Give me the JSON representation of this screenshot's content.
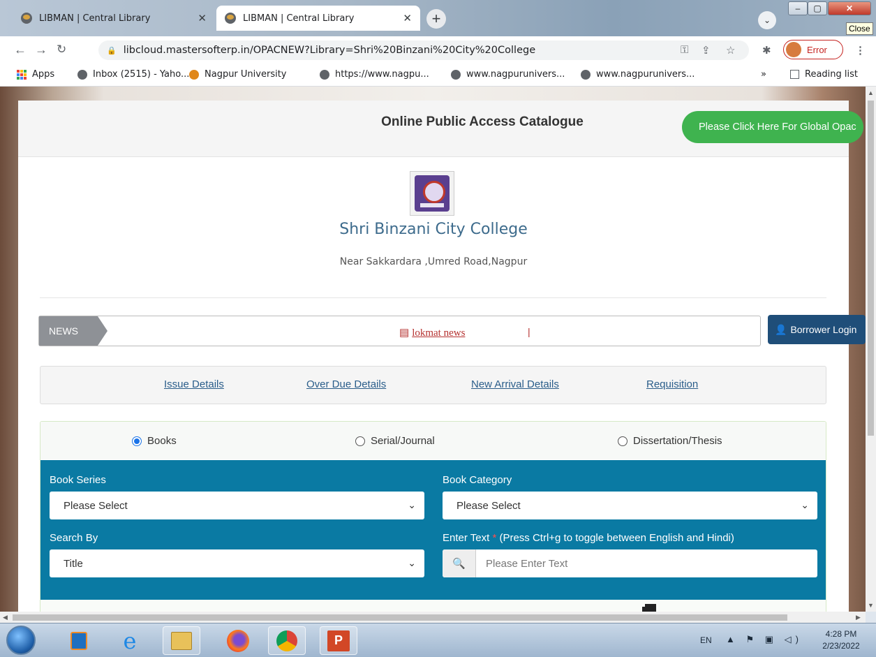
{
  "browser": {
    "tabs": [
      {
        "label": "LIBMAN | Central Library",
        "active": false
      },
      {
        "label": "LIBMAN | Central Library",
        "active": true
      }
    ],
    "close_tooltip": "Close",
    "url": "libcloud.mastersofterp.in/OPACNEW?Library=Shri%20Binzani%20City%20College",
    "profile_status": "Error",
    "bookmarks": [
      "Apps",
      "Inbox (2515) - Yaho...",
      "Nagpur University",
      "https://www.nagpu...",
      "www.nagpurunivers...",
      "www.nagpurunivers..."
    ],
    "bookmarks_overflow": "»",
    "reading_list": "Reading list"
  },
  "page": {
    "header_title": "Online Public Access Catalogue",
    "global_opac_button": "Please Click Here For Global Opac",
    "college_name": "Shri Binzani City College",
    "college_address": "Near Sakkardara ,Umred Road,Nagpur",
    "news": {
      "label": "NEWS",
      "item": "lokmat news",
      "separator": "|"
    },
    "borrower_login": "Borrower Login",
    "links": [
      "Issue Details",
      "Over Due Details",
      "New Arrival Details",
      "Requisition"
    ],
    "material_types": [
      {
        "label": "Books",
        "selected": true
      },
      {
        "label": "Serial/Journal",
        "selected": false
      },
      {
        "label": "Dissertation/Thesis",
        "selected": false
      }
    ],
    "form": {
      "book_series_label": "Book Series",
      "book_series_value": "Please Select",
      "book_category_label": "Book Category",
      "book_category_value": "Please Select",
      "search_by_label": "Search By",
      "search_by_value": "Title",
      "enter_text_label": "Enter Text",
      "enter_text_required": "*",
      "enter_text_hint": "(Press Ctrl+g to toggle between English and Hindi)",
      "enter_text_placeholder": "Please Enter Text"
    }
  },
  "taskbar": {
    "language": "EN",
    "time": "4:28 PM",
    "date": "2/23/2022"
  },
  "colors": {
    "accent_blue": "#0a7aa3",
    "global_button_green": "#3fb34f",
    "borrower_button_navy": "#1f4e79",
    "news_red": "#b5302e",
    "link_blue": "#2a5d8a"
  }
}
